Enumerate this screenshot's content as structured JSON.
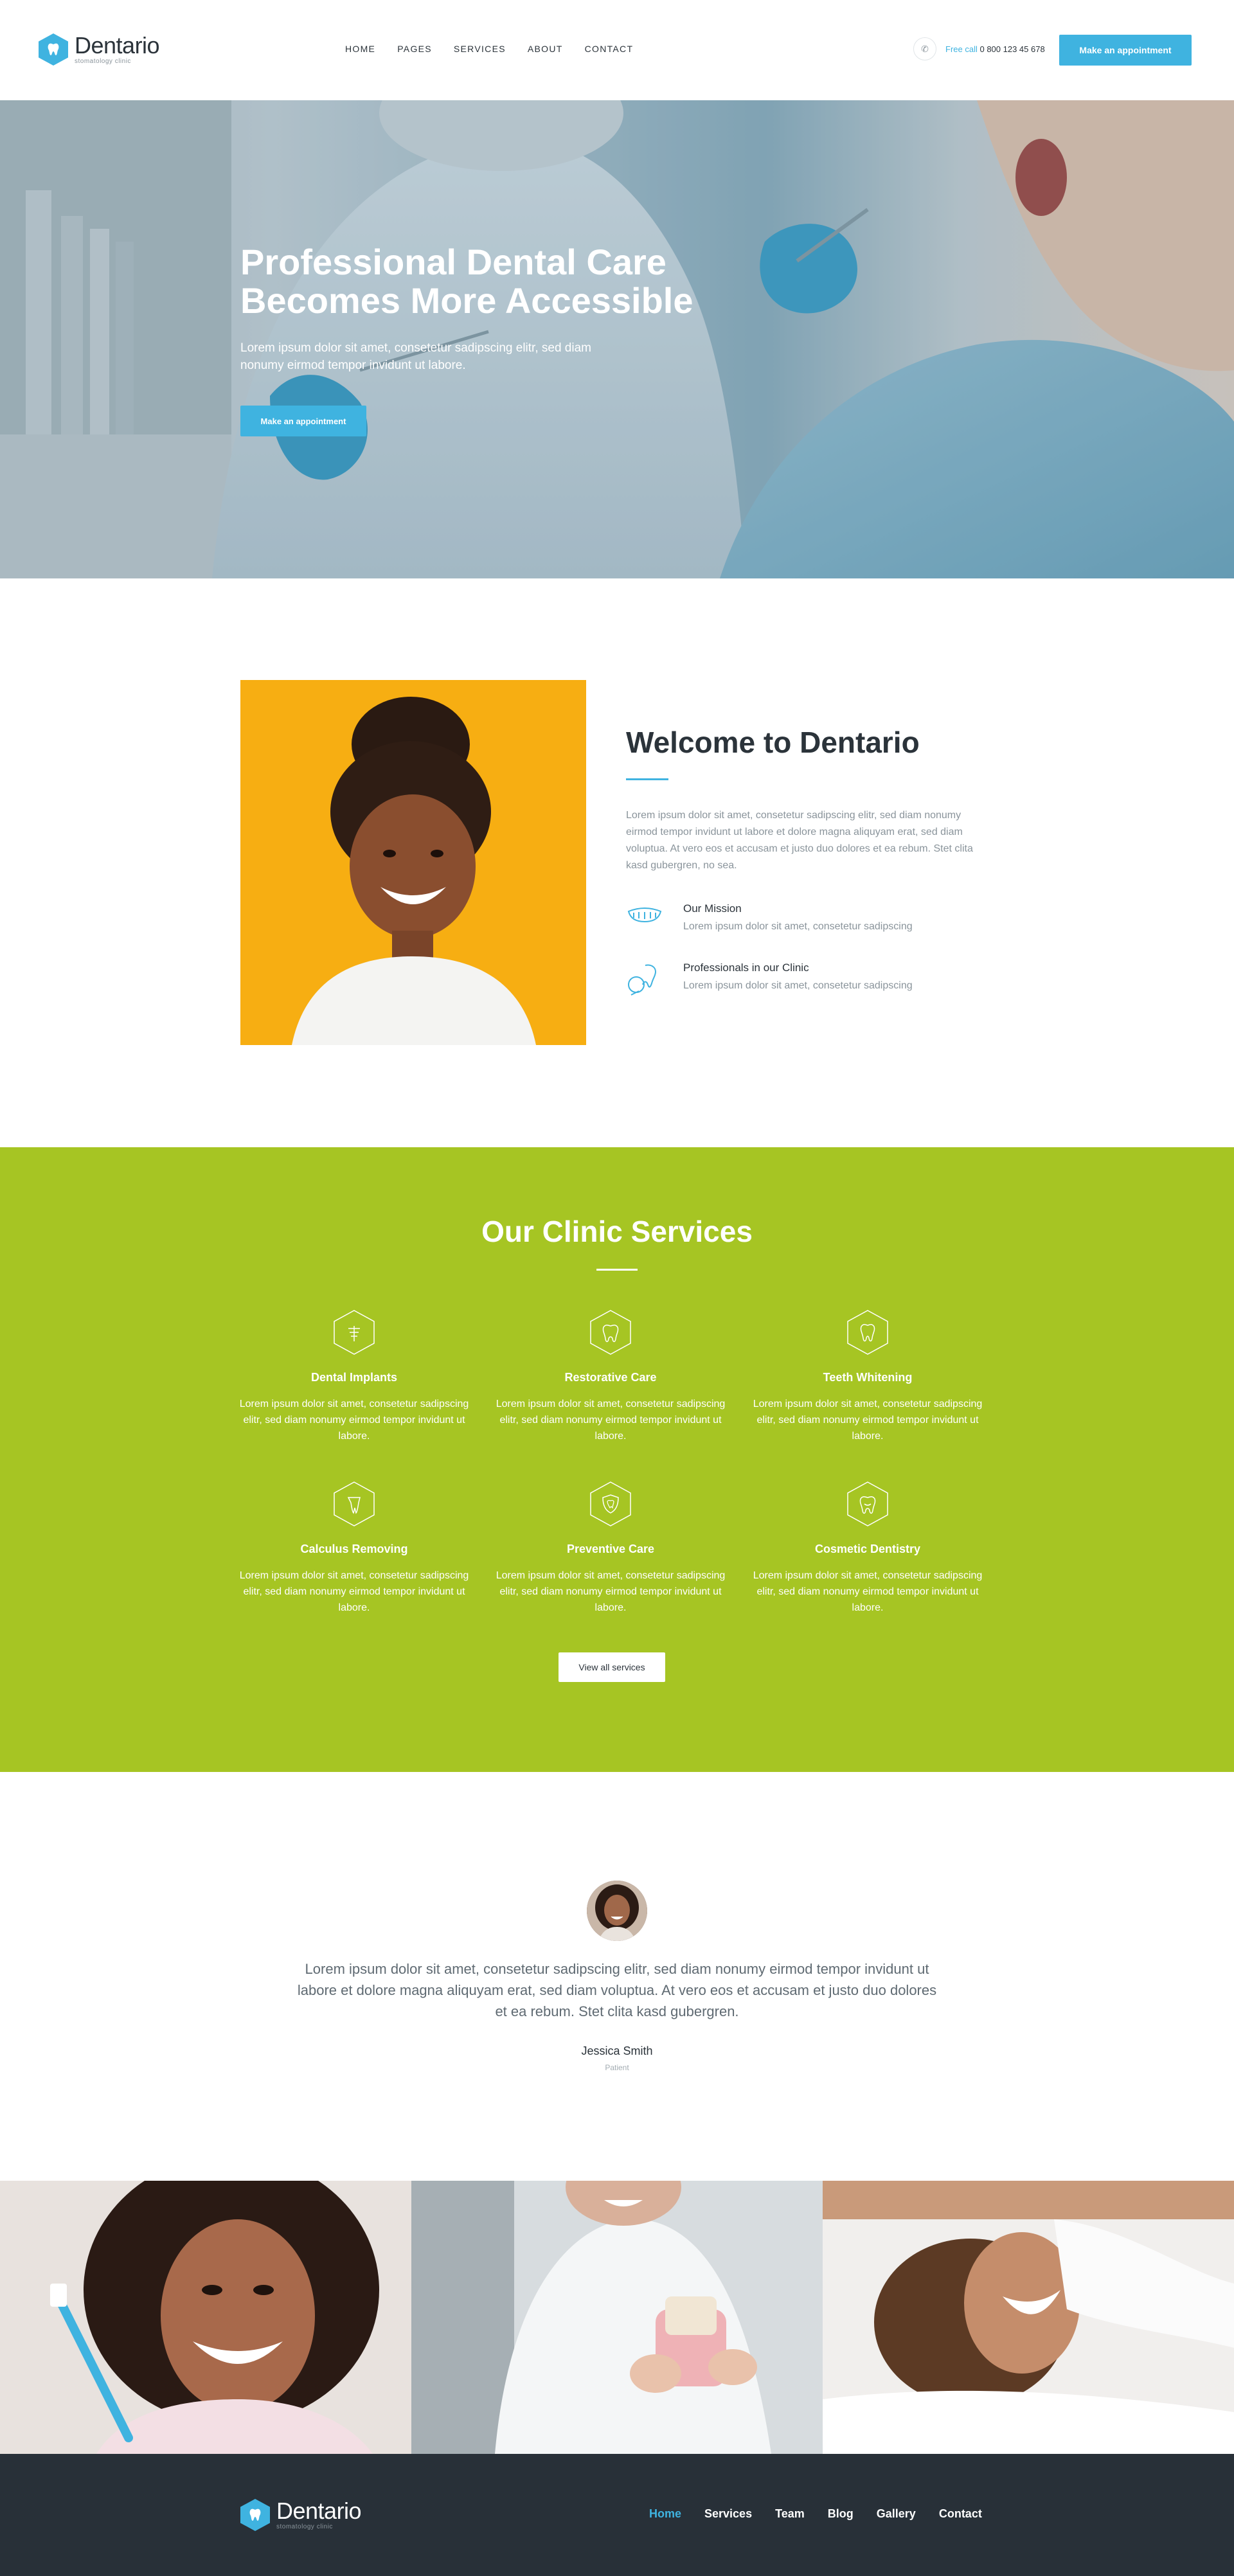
{
  "header": {
    "logo_name": "Dentario",
    "logo_sub": "stomatology clinic",
    "nav": [
      "HOME",
      "PAGES",
      "SERVICES",
      "ABOUT",
      "CONTACT"
    ],
    "phone_label": "Free call",
    "phone_number": "0 800 123 45 678",
    "cta": "Make an appointment"
  },
  "hero": {
    "title": "Professional Dental Care Becomes More Accessible",
    "description": "Lorem ipsum dolor sit amet, consetetur sadipscing elitr, sed diam nonumy eirmod tempor invidunt ut labore.",
    "cta": "Make an appointment"
  },
  "welcome": {
    "title": "Welcome to Dentario",
    "description": "Lorem ipsum dolor sit amet, consetetur sadipscing elitr, sed diam nonumy eirmod tempor invidunt ut labore et dolore magna aliquyam erat, sed diam voluptua. At vero eos et accusam et justo duo dolores et ea rebum. Stet clita kasd gubergren, no sea.",
    "features": [
      {
        "title": "Our Mission",
        "description": "Lorem ipsum dolor sit amet, consetetur sadipscing",
        "icon": "teeth-icon"
      },
      {
        "title": "Professionals in our Clinic",
        "description": "Lorem ipsum dolor sit amet, consetetur sadipscing",
        "icon": "dental-tools-icon"
      }
    ]
  },
  "services": {
    "title": "Our Clinic Services",
    "items": [
      {
        "title": "Dental Implants",
        "description": "Lorem ipsum dolor sit amet, consetetur sadipscing elitr, sed diam nonumy eirmod tempor invidunt ut labore.",
        "icon": "implant-icon"
      },
      {
        "title": "Restorative Care",
        "description": "Lorem ipsum dolor sit amet, consetetur sadipscing elitr, sed diam nonumy eirmod tempor invidunt ut labore.",
        "icon": "tooth-care-icon"
      },
      {
        "title": "Teeth Whitening",
        "description": "Lorem ipsum dolor sit amet, consetetur sadipscing elitr, sed diam nonumy eirmod tempor invidunt ut labore.",
        "icon": "tooth-icon"
      },
      {
        "title": "Calculus Removing",
        "description": "Lorem ipsum dolor sit amet, consetetur sadipscing elitr, sed diam nonumy eirmod tempor invidunt ut labore.",
        "icon": "calculus-icon"
      },
      {
        "title": "Preventive Care",
        "description": "Lorem ipsum dolor sit amet, consetetur sadipscing elitr, sed diam nonumy eirmod tempor invidunt ut labore.",
        "icon": "shield-tooth-icon"
      },
      {
        "title": "Cosmetic Dentistry",
        "description": "Lorem ipsum dolor sit amet, consetetur sadipscing elitr, sed diam nonumy eirmod tempor invidunt ut labore.",
        "icon": "smile-tooth-icon"
      }
    ],
    "cta": "View all services"
  },
  "testimonial": {
    "quote": "Lorem ipsum dolor sit amet, consetetur sadipscing elitr, sed diam nonumy eirmod tempor invidunt ut labore et dolore magna aliquyam erat, sed diam voluptua. At vero eos et accusam et justo duo dolores et ea rebum. Stet clita kasd gubergren.",
    "name": "Jessica Smith",
    "role": "Patient"
  },
  "footer": {
    "logo_name": "Dentario",
    "logo_sub": "stomatology clinic",
    "nav": [
      "Home",
      "Services",
      "Team",
      "Blog",
      "Gallery",
      "Contact"
    ]
  },
  "colors": {
    "accent": "#3fb3e0",
    "services_bg": "#a6c523",
    "footer_bg": "#283038",
    "text_dark": "#2b333a",
    "text_muted": "#8a949b"
  }
}
